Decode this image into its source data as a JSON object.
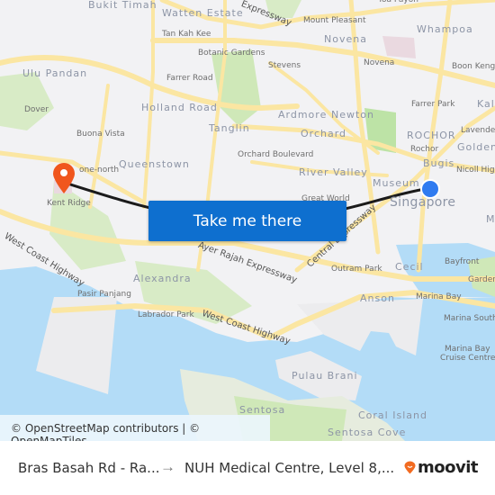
{
  "map": {
    "labels": {
      "bukit_timah": "Bukit Timah",
      "watten_estate": "Watten Estate",
      "tan_kah_kee": "Tan Kah Kee",
      "botanic_gardens": "Botanic Gardens",
      "farrer_road": "Farrer Road",
      "holland_road": "Holland Road",
      "tanglin": "Tanglin",
      "ulu_pandan": "Ulu Pandan",
      "dover": "Dover",
      "buona_vista": "Buona Vista",
      "one_north": "one-north",
      "queenstown": "Queenstown",
      "kent_ridge": "Kent Ridge",
      "west_coast_highway_1": "West Coast Highway",
      "alexandra": "Alexandra",
      "pasir_panjang": "Pasir Panjang",
      "labrador_park": "Labrador Park",
      "west_coast_highway_2": "West Coast Highway",
      "ayer_rajah": "Ayer Rajah Expressway",
      "expressway_top": "Expressway",
      "mount_pleasant": "Mount Pleasant",
      "novena_area": "Novena",
      "novena": "Novena",
      "toa_payoh": "Toa Payoh",
      "whampoa": "Whampoa",
      "boon_keng": "Boon Keng",
      "stevens": "Stevens",
      "ardmore": "Ardmore",
      "newton": "Newton",
      "farrer_park": "Farrer Park",
      "kallang": "Kall",
      "orchard": "Orchard",
      "orchard_boulevard": "Orchard Boulevard",
      "rochor_area": "ROCHOR",
      "rochor": "Rochor",
      "lavender": "Lavender",
      "golden": "Golden",
      "bugis": "Bugis",
      "nicoll_highway": "Nicoll High",
      "river_valley": "River Valley",
      "museum": "Museum",
      "great_world": "Great World",
      "singapore": "Singapore",
      "marina_partial": "M",
      "central_expressway": "Central Expressway",
      "outram_park": "Outram Park",
      "cecil": "Cecil",
      "bayfront": "Bayfront",
      "gardens": "Garden",
      "anson": "Anson",
      "marina_bay": "Marina Bay",
      "marina_south": "Marina South",
      "marina_bay_cruise_1": "Marina Bay",
      "marina_bay_cruise_2": "Cruise Centre",
      "pulau_brani": "Pulau Brani",
      "sentosa": "Sentosa",
      "coral_island": "Coral Island",
      "sentosa_cove": "Sentosa Cove"
    },
    "attribution": "© OpenStreetMap contributors | © OpenMapTiles",
    "cta_label": "Take me there",
    "colors": {
      "origin_dot": "#2f7bf0",
      "destination_pin": "#f0561d",
      "cta": "#0e6fcf",
      "water": "#b3dcf7",
      "road": "#fbe6a2",
      "park": "#cfe8b8"
    }
  },
  "footer": {
    "from": "Bras Basah Rd - Ra...",
    "arrow": "→",
    "to": "NUH Medical Centre, Level 8,...",
    "brand": "moovit"
  }
}
